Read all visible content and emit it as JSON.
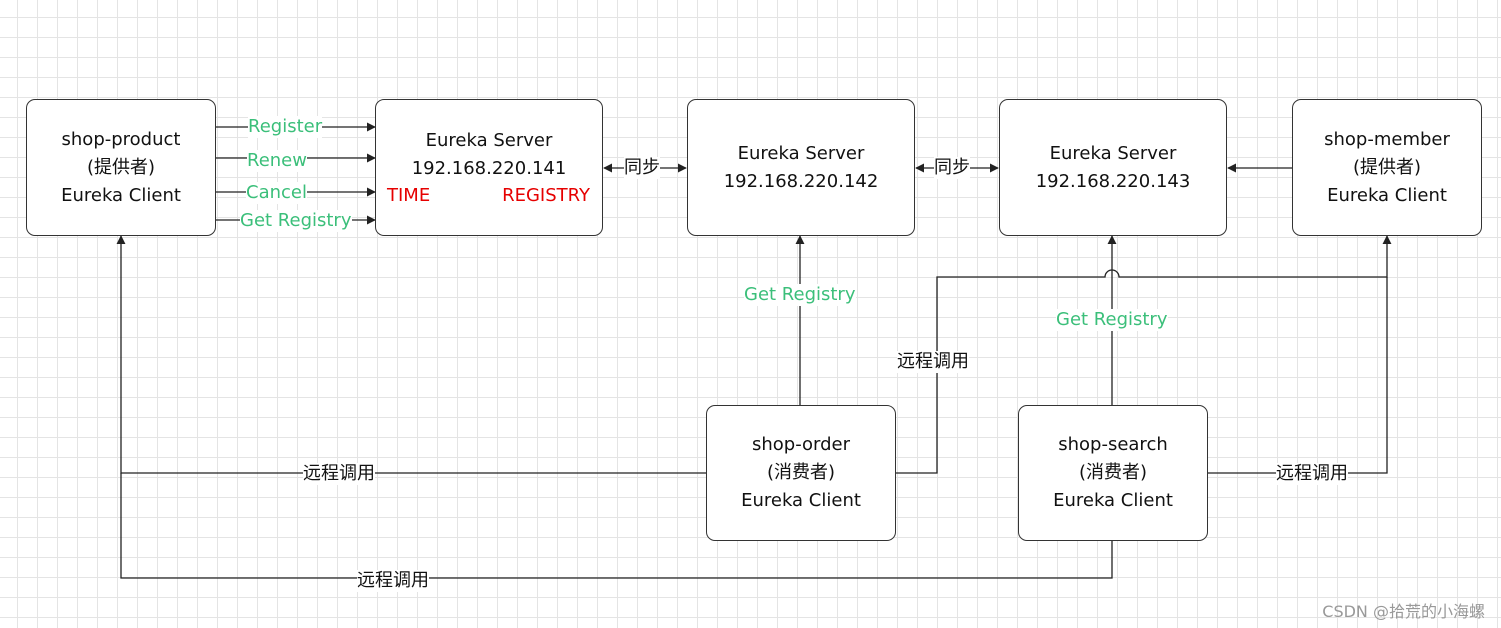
{
  "nodes": {
    "product": {
      "name": "shop-product",
      "role": "(提供者)",
      "type": "Eureka Client"
    },
    "server1": {
      "name": "Eureka Server",
      "ip": "192.168.220.141",
      "time": "TIME",
      "registry": "REGISTRY"
    },
    "server2": {
      "name": "Eureka Server",
      "ip": "192.168.220.142"
    },
    "server3": {
      "name": "Eureka Server",
      "ip": "192.168.220.143"
    },
    "member": {
      "name": "shop-member",
      "role": "(提供者)",
      "type": "Eureka Client"
    },
    "order": {
      "name": "shop-order",
      "role": "(消费者)",
      "type": "Eureka Client"
    },
    "search": {
      "name": "shop-search",
      "role": "(消费者)",
      "type": "Eureka Client"
    }
  },
  "edges": {
    "register": "Register",
    "renew": "Renew",
    "cancel": "Cancel",
    "get_registry": "Get Registry",
    "sync_1": "同步",
    "sync_2": "同步",
    "order_get_registry": "Get Registry",
    "search_get_registry": "Get Registry",
    "remote_call_order_member": "远程调用",
    "remote_call_order_product": "远程调用",
    "remote_call_search_member": "远程调用",
    "remote_call_search_product": "远程调用"
  },
  "colors": {
    "green": "#3bbf7a",
    "red": "#e60000",
    "line": "#222222",
    "grid": "#e4e4e4"
  },
  "watermark": "CSDN @拾荒的小海螺"
}
